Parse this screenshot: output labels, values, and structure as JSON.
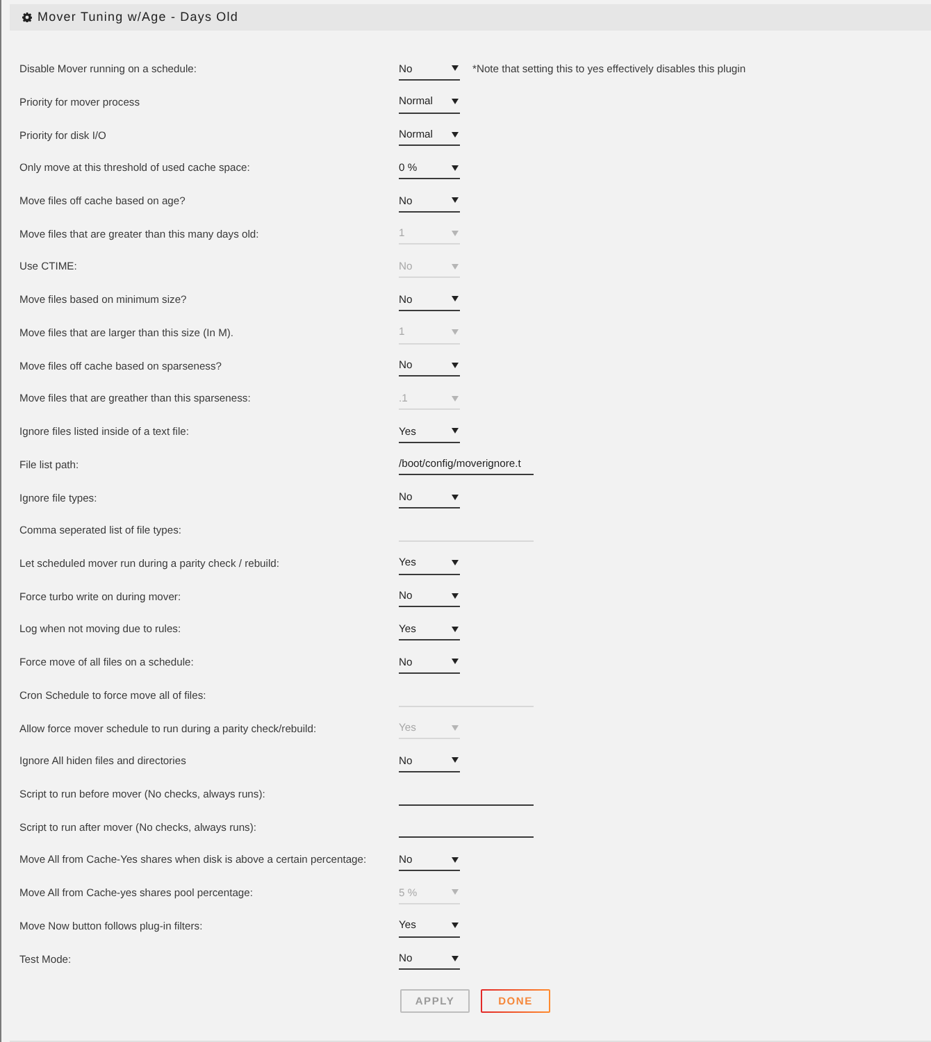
{
  "panel": {
    "title": "Mover Tuning w/Age - Days Old"
  },
  "settings": [
    {
      "label": "Disable Mover running on a schedule:",
      "kind": "select",
      "value": "No",
      "disabled": false,
      "note": "*Note that setting this to yes effectively disables this plugin"
    },
    {
      "label": "Priority for mover process",
      "kind": "select",
      "value": "Normal",
      "disabled": false
    },
    {
      "label": "Priority for disk I/O",
      "kind": "select",
      "value": "Normal",
      "disabled": false
    },
    {
      "label": "Only move at this threshold of used cache space:",
      "kind": "select",
      "value": "0 %",
      "disabled": false
    },
    {
      "label": "Move files off cache based on age?",
      "kind": "select",
      "value": "No",
      "disabled": false
    },
    {
      "label": "Move files that are greater than this many days old:",
      "kind": "select",
      "value": "1",
      "disabled": true
    },
    {
      "label": "Use CTIME:",
      "kind": "select",
      "value": "No",
      "disabled": true
    },
    {
      "label": "Move files based on minimum size?",
      "kind": "select",
      "value": "No",
      "disabled": false
    },
    {
      "label": "Move files that are larger than this size (In M).",
      "kind": "select",
      "value": "1",
      "disabled": true
    },
    {
      "label": "Move files off cache based on sparseness?",
      "kind": "select",
      "value": "No",
      "disabled": false
    },
    {
      "label": "Move files that are greather than this sparseness:",
      "kind": "select",
      "value": ".1",
      "disabled": true
    },
    {
      "label": "Ignore files listed inside of a text file:",
      "kind": "select",
      "value": "Yes",
      "disabled": false
    },
    {
      "label": "File list path:",
      "kind": "text",
      "value": "/boot/config/moverignore.t",
      "disabled": false
    },
    {
      "label": "Ignore file types:",
      "kind": "select",
      "value": "No",
      "disabled": false
    },
    {
      "label": "Comma seperated list of file types:",
      "kind": "text",
      "disabled": true
    },
    {
      "label": "Let scheduled mover run during a parity check / rebuild:",
      "kind": "select",
      "value": "Yes",
      "disabled": false
    },
    {
      "label": "Force turbo write on during mover:",
      "kind": "select",
      "value": "No",
      "disabled": false
    },
    {
      "label": "Log when not moving due to rules:",
      "kind": "select",
      "value": "Yes",
      "disabled": false
    },
    {
      "label": "Force move of all files on a schedule:",
      "kind": "select",
      "value": "No",
      "disabled": false
    },
    {
      "label": "Cron Schedule to force move all of files:",
      "kind": "text",
      "disabled": true
    },
    {
      "label": "Allow force mover schedule to run during a parity check/rebuild:",
      "kind": "select",
      "value": "Yes",
      "disabled": true
    },
    {
      "label": "Ignore All hiden files and directories",
      "kind": "select",
      "value": "No",
      "disabled": false
    },
    {
      "label": "Script to run before mover (No checks, always runs):",
      "kind": "text",
      "disabled": false
    },
    {
      "label": "Script to run after mover (No checks, always runs):",
      "kind": "text",
      "disabled": false
    },
    {
      "label": "Move All from Cache-Yes shares when disk is above a certain percentage:",
      "kind": "select",
      "value": "No",
      "disabled": false
    },
    {
      "label": "Move All from Cache-yes shares pool percentage:",
      "kind": "select",
      "value": "5 %",
      "disabled": true
    },
    {
      "label": "Move Now button follows plug-in filters:",
      "kind": "select",
      "value": "Yes",
      "disabled": false
    },
    {
      "label": "Test Mode:",
      "kind": "select",
      "value": "No",
      "disabled": false
    }
  ],
  "buttons": [
    {
      "label": "APPLY",
      "disabled": true
    },
    {
      "label": "DONE",
      "disabled": false
    }
  ]
}
